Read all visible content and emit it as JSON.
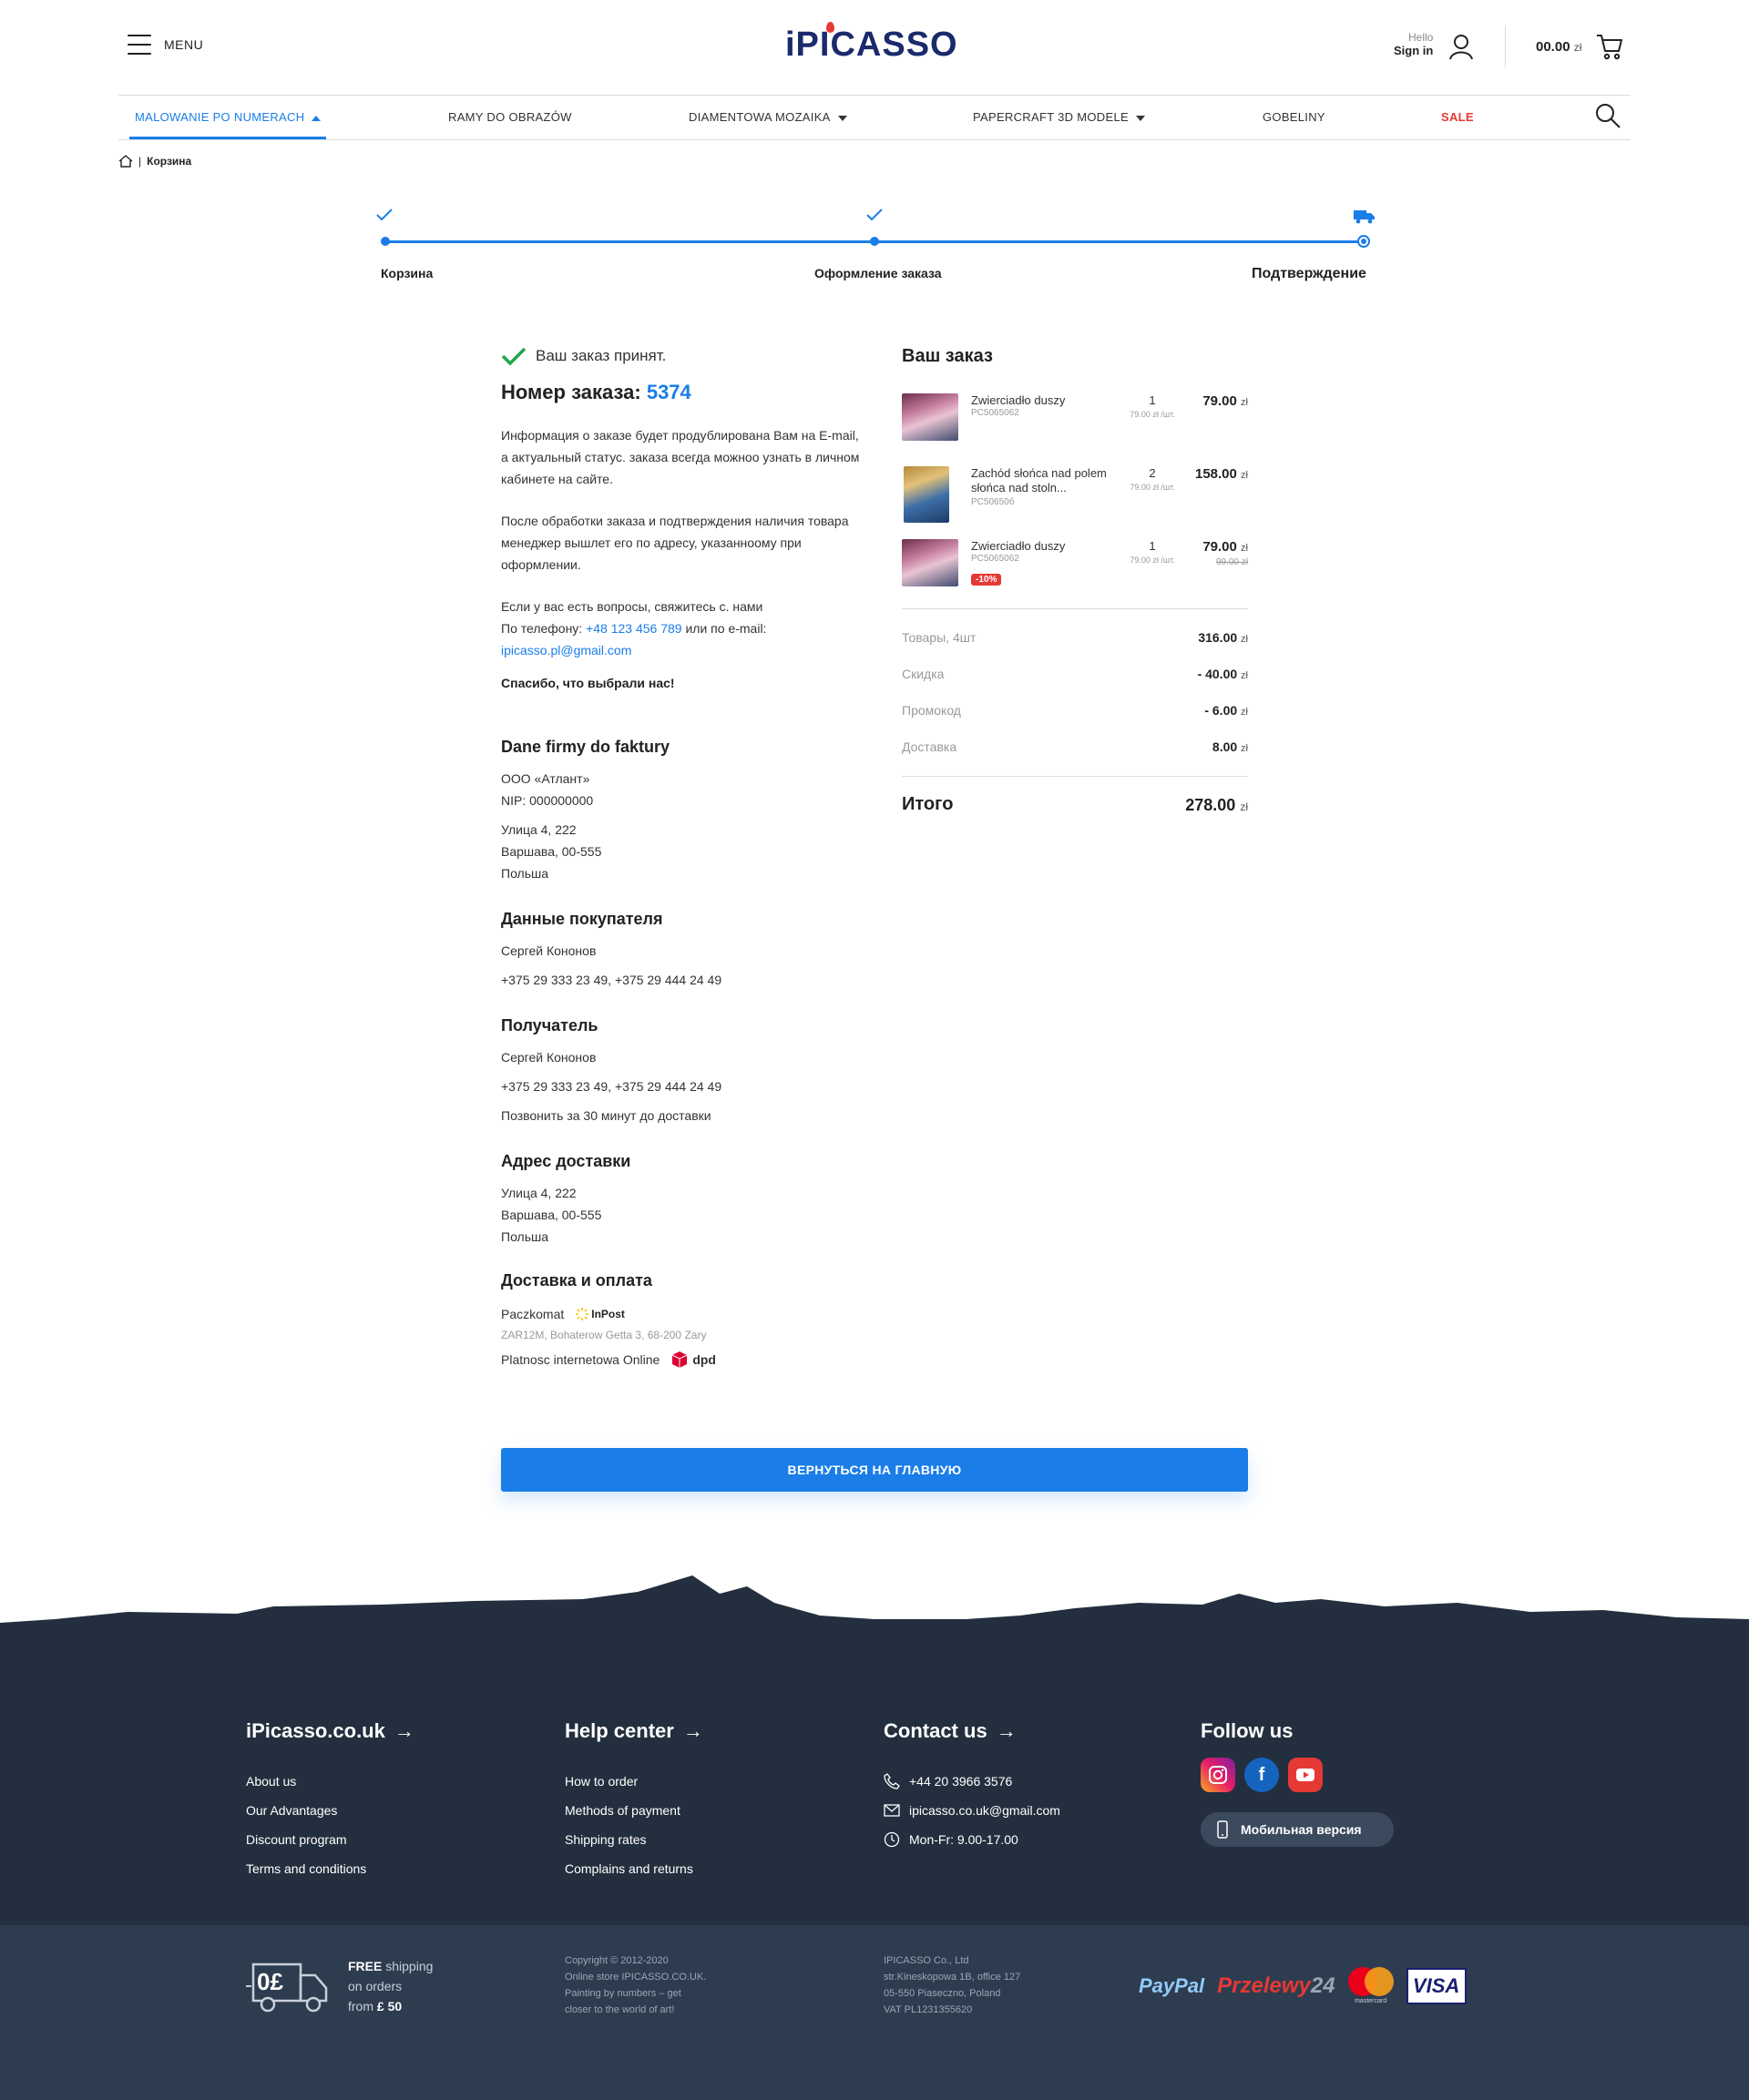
{
  "header": {
    "menu_label": "MENU",
    "logo_text": "iPICASSO",
    "hello": "Hello",
    "sign_in": "Sign in",
    "cart_total": "00.00",
    "currency": "zł"
  },
  "nav": {
    "items": [
      {
        "label": "MALOWANIE PO NUMERACH"
      },
      {
        "label": "RAMY DO OBRAZÓW"
      },
      {
        "label": "DIAMENTOWA MOZAIKA"
      },
      {
        "label": "PAPERCRAFT 3D MODELE"
      },
      {
        "label": "GOBELINY"
      },
      {
        "label": "SALE"
      }
    ]
  },
  "breadcrumb": {
    "separator": "|",
    "current": "Корзина"
  },
  "steps": [
    {
      "label": "Корзина"
    },
    {
      "label": "Оформление заказа"
    },
    {
      "label": "Подтверждение"
    }
  ],
  "order": {
    "accepted": "Ваш заказ принят.",
    "number_label": "Номер заказа:",
    "number": "5374",
    "info_text": "Информация о заказе будет продублирована Вам на E-mail, а актуальный статус. заказа всегда можноо узнать в личном кабинете на сайте.",
    "processing_text": "После обработки заказа и подтверждения наличия товара менеджер вышлет его по адресу, указанноому при оформлении.",
    "questions_text": "Если у вас есть вопросы, свяжитесь с. нами",
    "phone_prefix": "По телефону:",
    "phone": "+48 123 456 789",
    "email_prefix": "или по e-mail:",
    "email": "ipicasso.pl@gmail.com",
    "thanks": "Спасибо, что выбрали нас!"
  },
  "company": {
    "title": "Dane firmy do faktury",
    "name": "ООО «Атлант»",
    "nip": "NIP: 000000000",
    "street": "Улица 4, 222",
    "city": "Варшава, 00-555",
    "country": "Польша"
  },
  "buyer": {
    "title": "Данные покупателя",
    "name": "Сергей Кононов",
    "phones": "+375 29 333 23 49, +375 29 444 24 49"
  },
  "recipient": {
    "title": "Получатель",
    "name": "Сергей Кононов",
    "phones": "+375 29 333 23 49, +375 29 444 24 49",
    "note": "Позвонить за 30 минут до доставки"
  },
  "address": {
    "title": "Адрес доставки",
    "street": "Улица 4, 222",
    "city": "Варшава, 00-555",
    "country": "Польша"
  },
  "delivery": {
    "title": "Доставка и оплата",
    "method": "Paczkomat",
    "method_logo": "InPost",
    "method_address": "ZAR12M, Bohaterow Getta 3, 68-200 Zary",
    "payment": "Platnosc internetowa Online",
    "payment_logo": "dpd"
  },
  "cart": {
    "title": "Ваш заказ",
    "items": [
      {
        "name": "Zwierciadło duszy",
        "code": "PC5065062",
        "qty": "1",
        "unit": "79.00 zł /шт.",
        "price": "79.00",
        "currency": "zł"
      },
      {
        "name": "Zachód słońca nad polem słońca nad stoln...",
        "code": "PC50650б",
        "qty": "2",
        "unit": "79.00 zł /шт.",
        "price": "158.00",
        "currency": "zł"
      },
      {
        "name": "Zwierciadło duszy",
        "code": "PC5065062",
        "qty": "1",
        "unit": "79.00 zł /шт.",
        "price": "79.00",
        "currency": "zł",
        "old_price": "99.00 zł",
        "badge": "-10%"
      }
    ],
    "summary": [
      {
        "label": "Товары, 4шт",
        "value": "316.00",
        "currency": "zł"
      },
      {
        "label": "Скидка",
        "value": "- 40.00",
        "currency": "zł"
      },
      {
        "label": "Промокод",
        "value": "- 6.00",
        "currency": "zł"
      },
      {
        "label": "Доставка",
        "value": "8.00",
        "currency": "zł"
      }
    ],
    "total_label": "Итого",
    "total_value": "278.00",
    "total_currency": "zł"
  },
  "back_button": "ВЕРНУТЬСЯ НА ГЛАВНУЮ",
  "footer": {
    "col1": {
      "title": "iPicasso.co.uk",
      "links": [
        "About us",
        "Our Advantages",
        "Discount program",
        "Terms and conditions"
      ]
    },
    "col2": {
      "title": "Help center",
      "links": [
        "How to order",
        "Methods of payment",
        "Shipping rates",
        "Complains and returns"
      ]
    },
    "col3": {
      "title": "Contact us",
      "phone": "+44 20 3966 3576",
      "email": "ipicasso.co.uk@gmail.com",
      "hours": "Mon-Fr: 9.00-17.00"
    },
    "col4": {
      "title": "Follow us",
      "mobile": "Мобильная версия"
    },
    "shipping": {
      "badge": "0£",
      "free": "FREE",
      "line1": "shipping",
      "line2": "on orders",
      "line3_prefix": "from",
      "amount": "£ 50"
    },
    "copyright": [
      "Copyright © 2012-2020",
      "Online store IPICASSO.CO.UK.",
      "Painting by numbers – get",
      "closer to the world of art!"
    ],
    "company": [
      "IPICASSO Co., Ltd",
      "str.Kineskopowa 1B, office 127",
      "05-550 Piaseczno, Poland",
      "VAT PL1231355620"
    ],
    "payments": {
      "paypal": "PayPal",
      "przelewy": "Przelewy",
      "przelewy_num": "24",
      "mastercard": "mastercard",
      "visa": "VISA"
    }
  },
  "colors": {
    "accent": "#1a7de8",
    "sale": "#e53935",
    "footer": "#232f3e",
    "success": "#20a84a"
  }
}
